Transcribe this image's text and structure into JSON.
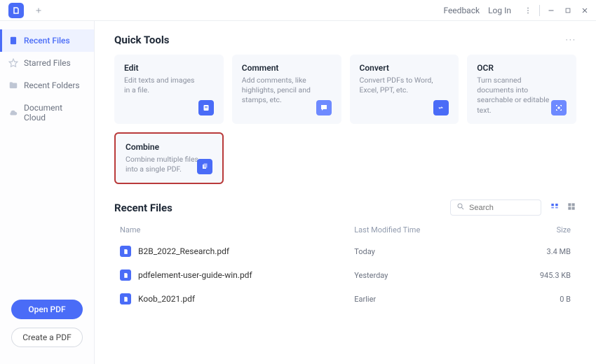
{
  "titlebar": {
    "feedback": "Feedback",
    "login": "Log In"
  },
  "sidebar": {
    "nav": [
      {
        "label": "Recent Files",
        "icon": "clock-file"
      },
      {
        "label": "Starred Files",
        "icon": "star"
      },
      {
        "label": "Recent Folders",
        "icon": "folder"
      },
      {
        "label": "Document Cloud",
        "icon": "cloud"
      }
    ],
    "open_pdf": "Open PDF",
    "create_pdf": "Create a PDF"
  },
  "quick_tools": {
    "heading": "Quick Tools",
    "items": [
      {
        "title": "Edit",
        "desc": "Edit texts and images in a file.",
        "icon": "edit"
      },
      {
        "title": "Comment",
        "desc": "Add comments, like highlights, pencil and stamps, etc.",
        "icon": "comment"
      },
      {
        "title": "Convert",
        "desc": "Convert PDFs to Word, Excel, PPT, etc.",
        "icon": "convert"
      },
      {
        "title": "OCR",
        "desc": "Turn scanned documents into searchable or editable text.",
        "icon": "ocr"
      },
      {
        "title": "Combine",
        "desc": "Combine multiple files into a single PDF.",
        "icon": "combine",
        "highlight": true
      }
    ]
  },
  "recent": {
    "heading": "Recent Files",
    "search_placeholder": "Search",
    "columns": {
      "name": "Name",
      "time": "Last Modified Time",
      "size": "Size"
    },
    "files": [
      {
        "name": "B2B_2022_Research.pdf",
        "time": "Today",
        "size": "3.4 MB"
      },
      {
        "name": "pdfelement-user-guide-win.pdf",
        "time": "Yesterday",
        "size": "945.3 KB"
      },
      {
        "name": "Koob_2021.pdf",
        "time": "Earlier",
        "size": "0 B"
      }
    ]
  }
}
